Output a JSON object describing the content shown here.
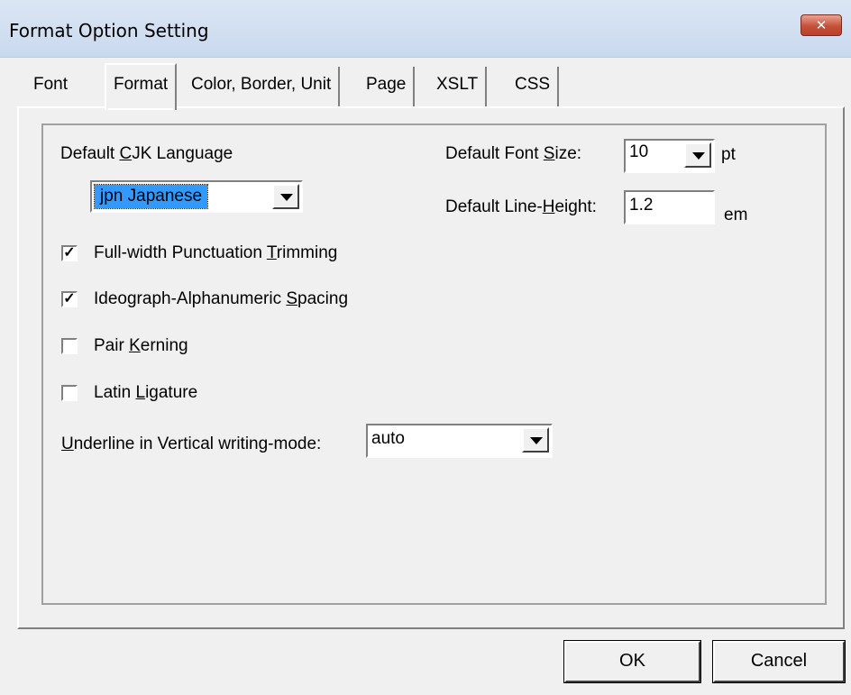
{
  "window": {
    "title": "Format Option Setting",
    "close_label": "✕"
  },
  "tabs": [
    {
      "label": "Font"
    },
    {
      "label": "Format"
    },
    {
      "label": "Color, Border, Unit"
    },
    {
      "label": "Page"
    },
    {
      "label": "XSLT"
    },
    {
      "label": "CSS"
    }
  ],
  "active_tab": "Format",
  "cjk": {
    "pre": "Default ",
    "u": "C",
    "post": "JK Language",
    "value": "jpn Japanese"
  },
  "font_size": {
    "pre": "Default Font ",
    "u": "S",
    "post": "ize:",
    "value": "10",
    "unit": "pt"
  },
  "line_height": {
    "pre": "Default Line-",
    "u": "H",
    "post": "eight:",
    "value": "1.2",
    "unit": "em"
  },
  "checkboxes": [
    {
      "pre": "Full-width Punctuation ",
      "u": "T",
      "post": "rimming",
      "checked": true,
      "mark": "✓"
    },
    {
      "pre": "Ideograph-Alphanumeric ",
      "u": "S",
      "post": "pacing",
      "checked": true,
      "mark": "✓"
    },
    {
      "pre": "Pair ",
      "u": "K",
      "post": "erning",
      "checked": false,
      "mark": ""
    },
    {
      "pre": "Latin ",
      "u": "L",
      "post": "igature",
      "checked": false,
      "mark": ""
    }
  ],
  "underline": {
    "pre": "",
    "u": "U",
    "post": "nderline in Vertical writing-mode:",
    "value": "auto"
  },
  "buttons": {
    "ok": "OK",
    "cancel": "Cancel"
  },
  "colors": {
    "selection": "#3399ff",
    "close": "#c6503a",
    "titlebar": "#c9d9ee"
  }
}
